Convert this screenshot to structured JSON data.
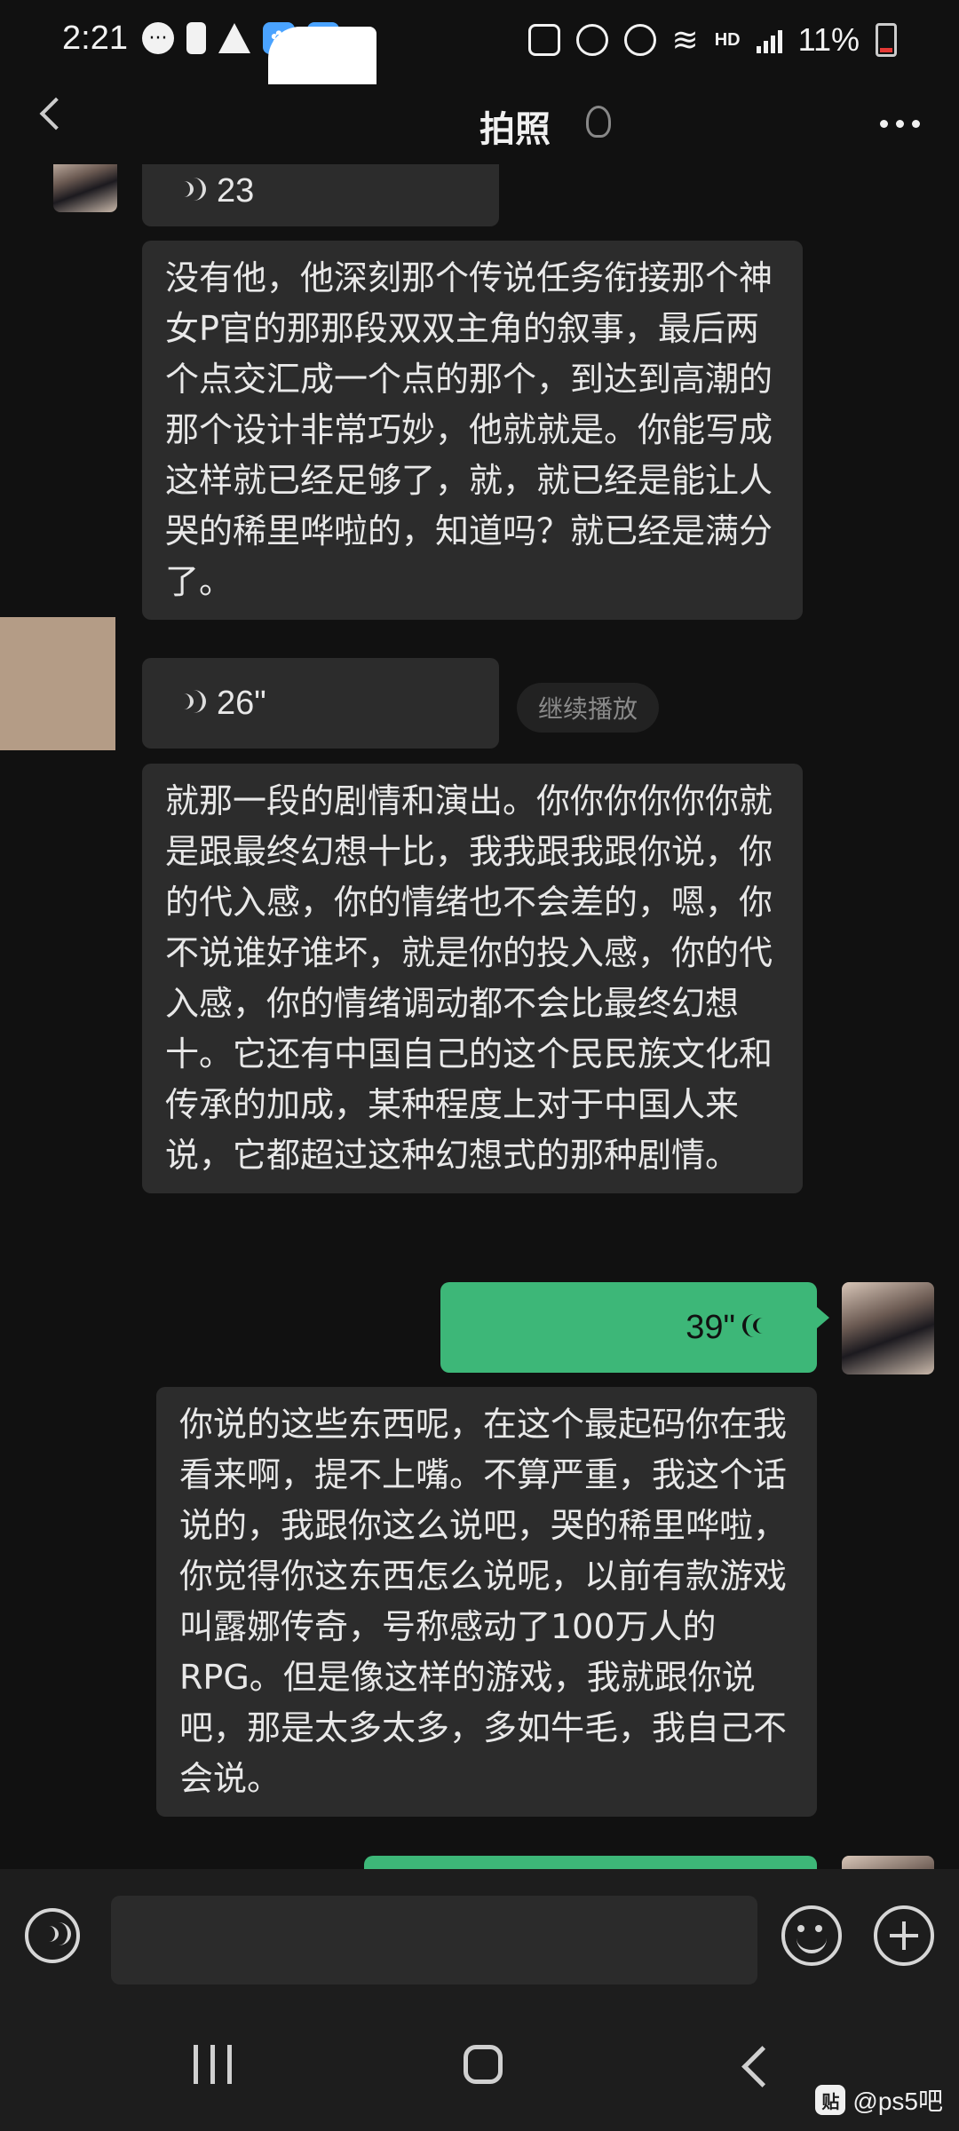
{
  "status_bar": {
    "time": "2:21",
    "battery": "11%",
    "hd": "HD"
  },
  "header": {
    "title": "拍照"
  },
  "messages": {
    "m0_voice_duration": "23",
    "m1_text": "没有他，他深刻那个传说任务衔接那个神女P官的那那段双双主角的叙事，最后两个点交汇成一个点的那个，到达到高潮的那个设计非常巧妙，他就就是。你能写成这样就已经足够了，就，就已经是能让人哭的稀里哗啦的，知道吗？就已经是满分了。",
    "m2_voice_duration": "26\"",
    "m2_continue_label": "继续播放",
    "m3_text": "就那一段的剧情和演出。你你你你你你就是跟最终幻想十比，我我跟我跟你说，你的代入感，你的情绪也不会差的，嗯，你不说谁好谁坏，就是你的投入感，你的代入感，你的情绪调动都不会比最终幻想十。它还有中国自己的这个民民族文化和传承的加成，某种程度上对于中国人来说，它都超过这种幻想式的那种剧情。",
    "m4_voice_duration": "39\"",
    "m5_text": "你说的这些东西呢，在这个最起码你在我看来啊，提不上嘴。不算严重，我这个话说的，我跟你这么说吧，哭的稀里哗啦，你觉得你这东西怎么说呢，以前有款游戏叫露娜传奇，号称感动了100万人的RPG。但是像这样的游戏，我就跟你说吧，那是太多太多，多如牛毛，我自己不会说。"
  },
  "watermark": {
    "logo": "贴",
    "text": "@ps5吧"
  },
  "colors": {
    "background": "#111111",
    "bubble_incoming": "#2c2c2c",
    "bubble_outgoing": "#3db778"
  }
}
